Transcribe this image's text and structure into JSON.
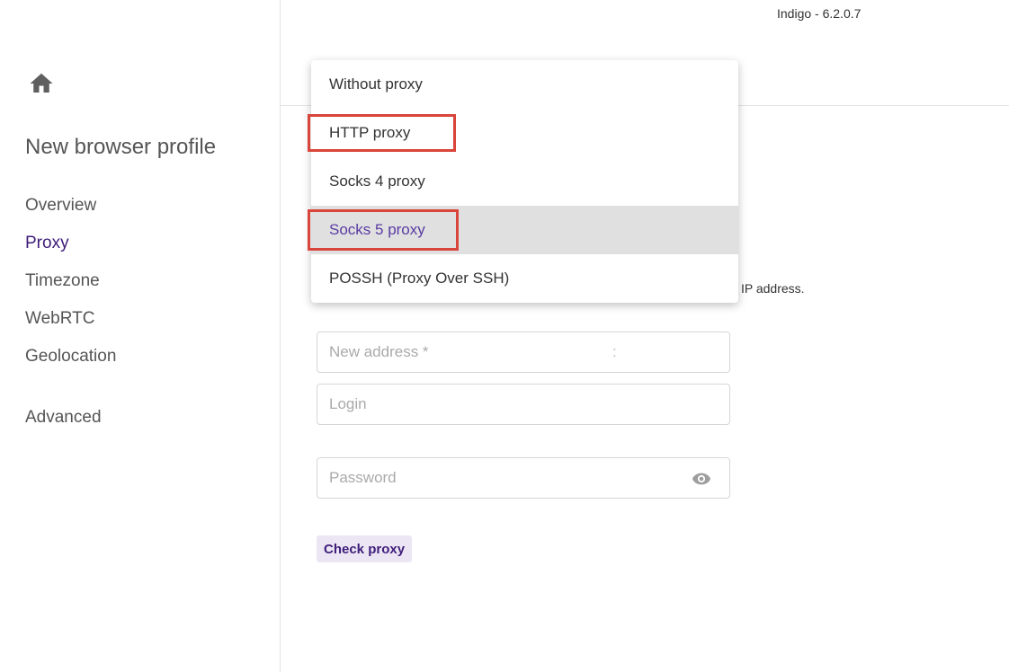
{
  "app": {
    "version": "Indigo - 6.2.0.7"
  },
  "sidebar": {
    "home_icon": "home-icon",
    "title": "New browser profile",
    "items": [
      {
        "label": "Overview"
      },
      {
        "label": "Proxy",
        "active": true
      },
      {
        "label": "Timezone"
      },
      {
        "label": "WebRTC"
      },
      {
        "label": "Geolocation"
      },
      {
        "label": "Advanced"
      }
    ]
  },
  "proxy_type_dropdown": {
    "options": [
      {
        "label": "Without proxy"
      },
      {
        "label": "HTTP proxy",
        "highlighted": true
      },
      {
        "label": "Socks 4 proxy"
      },
      {
        "label": "Socks 5 proxy",
        "selected": true,
        "highlighted": true
      },
      {
        "label": "POSSH (Proxy Over SSH)"
      }
    ]
  },
  "proxy_form": {
    "info_text_fragment": "IP address.",
    "address_placeholder": "New address *",
    "address_separator": ":",
    "login_placeholder": "Login",
    "password_placeholder": "Password",
    "password_icon": "eye-icon",
    "check_button": "Check proxy"
  },
  "colors": {
    "accent": "#3f1d7a",
    "button_bg": "#ece6f4",
    "highlight_border": "#d9453a",
    "selected_option_bg": "#e0e0e0"
  }
}
